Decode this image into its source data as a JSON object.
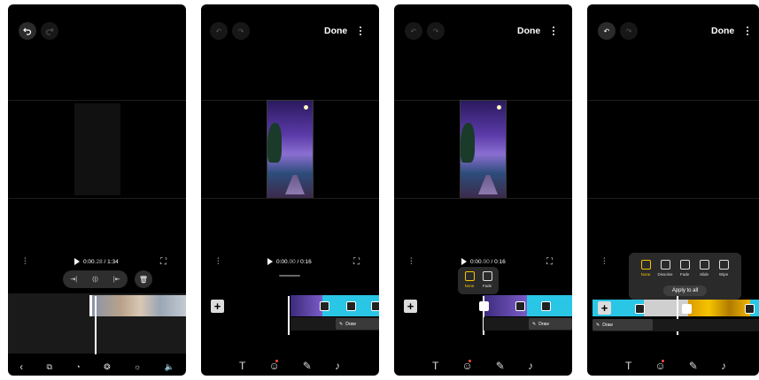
{
  "screens": [
    {
      "time_current": "0:00",
      "time_frac": ".28",
      "time_total": "/ 1:34",
      "clip_tools": [
        "trim-start-icon",
        "split-icon",
        "trim-end-icon"
      ],
      "delete_icon": "trash-icon",
      "bottom_tools": [
        "back-icon",
        "crop-icon",
        "speed-icon",
        "filter-icon",
        "adjust-icon",
        "volume-icon"
      ]
    },
    {
      "done_label": "Done",
      "time_current": "0:00",
      "time_frac": ".00",
      "time_total": "/ 0:16",
      "draw_label": "Draw",
      "bottom_tools": [
        "text-icon",
        "sticker-icon",
        "draw-icon",
        "music-icon"
      ]
    },
    {
      "done_label": "Done",
      "time_current": "0:00",
      "time_frac": ".00",
      "time_total": "/ 0:16",
      "draw_label": "Draw",
      "transition_options": [
        {
          "label": "None",
          "selected": true
        },
        {
          "label": "Fade",
          "selected": false
        }
      ],
      "bottom_tools": [
        "text-icon",
        "sticker-icon",
        "draw-icon",
        "music-icon"
      ]
    },
    {
      "done_label": "Done",
      "draw_label": "Draw",
      "transition_options": [
        {
          "label": "None",
          "selected": true
        },
        {
          "label": "Dissolve",
          "selected": false
        },
        {
          "label": "Fade",
          "selected": false
        },
        {
          "label": "Slide",
          "selected": false
        },
        {
          "label": "Wipe",
          "selected": false
        }
      ],
      "apply_all_label": "Apply to all",
      "bottom_tools": [
        "text-icon",
        "sticker-icon",
        "draw-icon",
        "music-icon"
      ]
    }
  ],
  "colors": {
    "accent_selected": "#f5c400",
    "timeline_cyan": "#29c6e6",
    "badge_red": "#ff4c3a"
  }
}
